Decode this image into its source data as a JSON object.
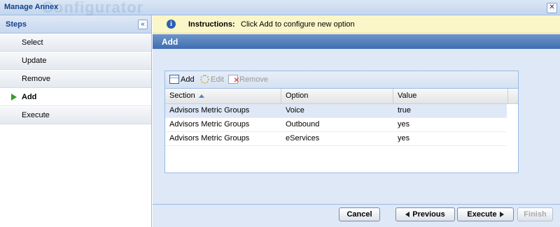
{
  "window": {
    "title": "Manage Annex",
    "ghost_text": "Configurator",
    "close_icon": "close-icon"
  },
  "sidebar": {
    "header": "Steps",
    "collapse_icon": "double-chevron-left-icon",
    "steps": [
      {
        "label": "Select",
        "active": false
      },
      {
        "label": "Update",
        "active": false
      },
      {
        "label": "Remove",
        "active": false
      },
      {
        "label": "Add",
        "active": true
      },
      {
        "label": "Execute",
        "active": false
      }
    ]
  },
  "instructions": {
    "icon": "info-icon",
    "label": "Instructions:",
    "text": "Click Add to configure new option"
  },
  "panel": {
    "title": "Add"
  },
  "grid": {
    "toolbar": {
      "add_label": "Add",
      "edit_label": "Edit",
      "remove_label": "Remove"
    },
    "columns": [
      "Section",
      "Option",
      "Value"
    ],
    "sort_column": "Section",
    "sort_direction": "asc",
    "rows": [
      {
        "section": "Advisors Metric Groups",
        "option": "Voice",
        "value": "true"
      },
      {
        "section": "Advisors Metric Groups",
        "option": "Outbound",
        "value": "yes"
      },
      {
        "section": "Advisors Metric Groups",
        "option": "eServices",
        "value": "yes"
      }
    ]
  },
  "footer": {
    "cancel": "Cancel",
    "previous": "Previous",
    "execute": "Execute",
    "finish": "Finish"
  },
  "colors": {
    "accent": "#15428b",
    "panel_header": "#4a78b8",
    "instructions_bg": "#fbf6c8",
    "active_arrow": "#3a9a2c"
  }
}
